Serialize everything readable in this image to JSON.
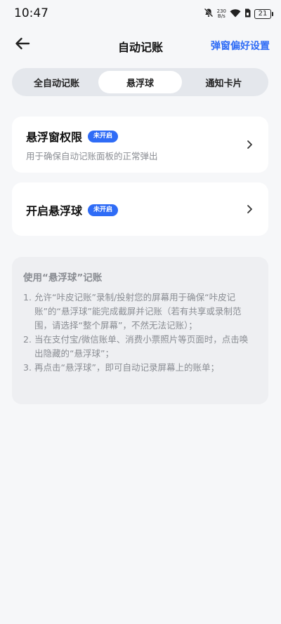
{
  "status_bar": {
    "time": "10:47",
    "net_speed_value": "230",
    "net_speed_unit": "B/s",
    "battery": "21",
    "icons": [
      "mute-bell-icon",
      "wifi-icon",
      "sim-icon",
      "battery-icon"
    ]
  },
  "header": {
    "back_icon": "arrow-left-icon",
    "title": "自动记账",
    "right_link": "弹窗偏好设置"
  },
  "tabs": [
    {
      "label": "全自动记账",
      "active": false
    },
    {
      "label": "悬浮球",
      "active": true
    },
    {
      "label": "通知卡片",
      "active": false
    }
  ],
  "cards": [
    {
      "title": "悬浮窗权限",
      "badge": "未开启",
      "subtitle": "用于确保自动记账面板的正常弹出"
    },
    {
      "title": "开启悬浮球",
      "badge": "未开启"
    }
  ],
  "info": {
    "title": "使用“悬浮球”记账",
    "items": [
      {
        "num": "1.",
        "text": "允许“咔皮记账”录制/投射您的屏幕用于确保“咔皮记账”的“悬浮球”能完成截屏并记账（若有共享或录制范围，请选择“整个屏幕”，不然无法记账）；"
      },
      {
        "num": "2.",
        "text": "当在支付宝/微信账单、消费小票照片等页面时，点击唤出隐藏的“悬浮球”；"
      },
      {
        "num": "3.",
        "text": "再点击“悬浮球”，即可自动记录屏幕上的账单；"
      }
    ]
  },
  "colors": {
    "accent": "#2f6cf6",
    "background": "#f6f7f9",
    "muted_text": "#8a8d93"
  }
}
